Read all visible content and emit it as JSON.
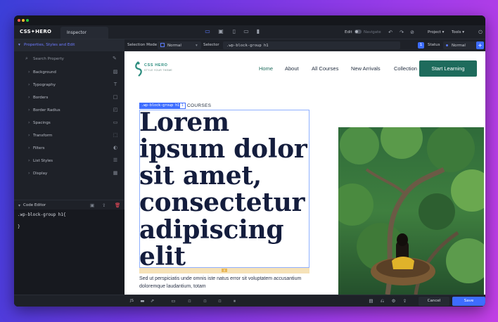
{
  "app": {
    "logo": "CSS✦HERO",
    "tab": "Inspector"
  },
  "toolbar": {
    "edit_label": "Edit",
    "navigate_label": "Navigate",
    "project_label": "Project ▾",
    "tools_label": "Tools ▾"
  },
  "selection_bar": {
    "mode_label": "Selection Mode",
    "mode_value": "Normal",
    "selector_label": "Selector",
    "selector_value": ".wp-block-group h1",
    "count": "1",
    "status_label": "Status",
    "status_value": "Normal"
  },
  "sidebar": {
    "header": "Properties, Styles and Edit",
    "search_placeholder": "Search Property",
    "items": [
      {
        "label": "Background",
        "icon": "image-icon"
      },
      {
        "label": "Typography",
        "icon": "text-icon"
      },
      {
        "label": "Borders",
        "icon": "border-icon"
      },
      {
        "label": "Border Radius",
        "icon": "radius-icon"
      },
      {
        "label": "Spacings",
        "icon": "spacing-icon"
      },
      {
        "label": "Transform",
        "icon": "transform-icon"
      },
      {
        "label": "Filters",
        "icon": "filter-icon"
      },
      {
        "label": "List Styles",
        "icon": "list-icon"
      },
      {
        "label": "Display",
        "icon": "display-icon"
      }
    ],
    "code_editor_title": "Code Editor",
    "code_line1": ".wp-block-group h1{",
    "code_line2": "}"
  },
  "page": {
    "logo_text": "CSS HERO",
    "logo_sub": "STYLE YOUR THEME",
    "nav": [
      "Home",
      "About",
      "All Courses",
      "New Arrivals",
      "Collection"
    ],
    "cta": "Start Learning",
    "badge": ".wp-block-group h1",
    "badge_num": "1",
    "eyebrow": "COURSES",
    "heading": "Lorem ipsum dolor sit amet, consectetur adipiscing elit",
    "paragraph": "Sed ut perspiciatis unde omnis iste natus error sit voluptatem accusantium doloremque laudantium, totam"
  },
  "bottom": {
    "js_label": "JS",
    "cancel": "Cancel",
    "save": "Save"
  },
  "colors": {
    "accent": "#3d6dff",
    "brand_green": "#1e6b5c",
    "heading": "#141d3d"
  }
}
